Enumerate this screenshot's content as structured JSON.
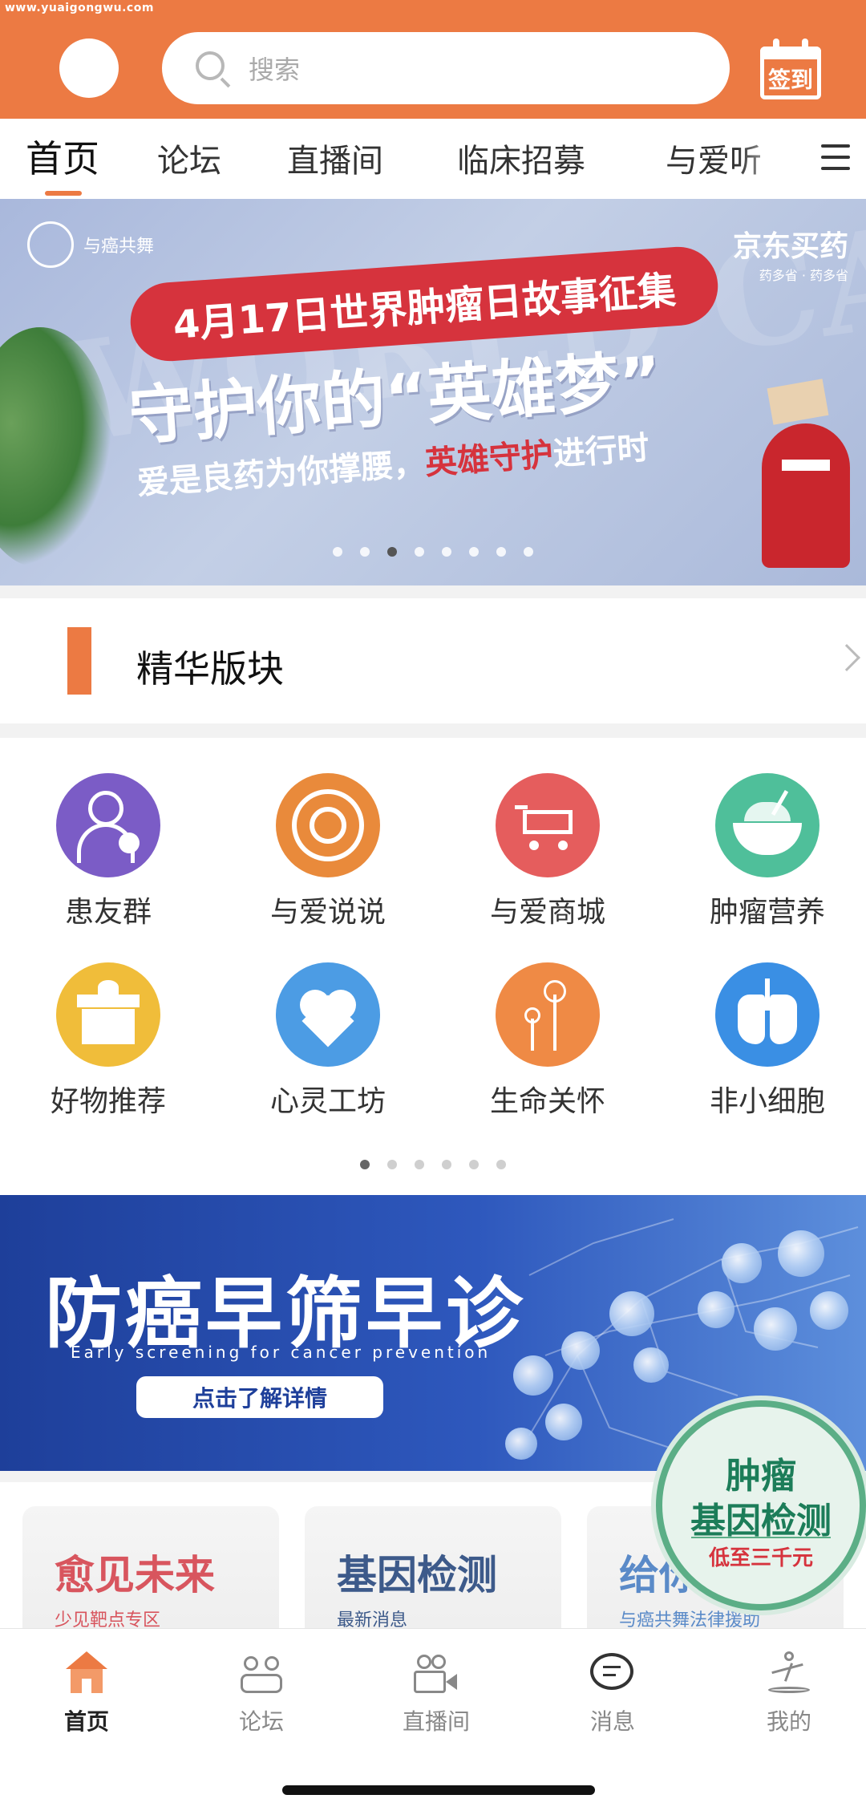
{
  "watermark": "www.yuaigongwu.com",
  "search": {
    "placeholder": "搜索"
  },
  "checkin": {
    "label": "签到"
  },
  "tabs": [
    {
      "label": "首页",
      "active": true
    },
    {
      "label": "论坛"
    },
    {
      "label": "直播间"
    },
    {
      "label": "临床招募"
    },
    {
      "label": "与爱听"
    }
  ],
  "banner": {
    "logo_left": "与癌共舞",
    "logo_right": "京东买药",
    "logo_right_sub": "药多省 · 药多省",
    "pill": "4月17日世界肿瘤日故事征集",
    "slogan": "守护你的“英雄梦”",
    "sub_white": "爱是良药为你撑腰，",
    "sub_red": "英雄守护",
    "sub_tail": "进行时",
    "dots_total": 8,
    "dots_active_index": 2
  },
  "featured": {
    "title": "精华版块"
  },
  "grid": {
    "items": [
      {
        "label": "患友群",
        "icon": "user-plus-icon",
        "color": "#7b5cc6"
      },
      {
        "label": "与爱说说",
        "icon": "camera-lens-icon",
        "color": "#e98a3b"
      },
      {
        "label": "与爱商城",
        "icon": "shopping-cart-icon",
        "color": "#e55d5d"
      },
      {
        "label": "肿瘤营养",
        "icon": "bowl-icon",
        "color": "#4fbf9a"
      },
      {
        "label": "好物推荐",
        "icon": "gift-box-icon",
        "color": "#f0bd3a"
      },
      {
        "label": "心灵工坊",
        "icon": "heart-pulse-icon",
        "color": "#4c9ce4"
      },
      {
        "label": "生命关怀",
        "icon": "dandelion-icon",
        "color": "#ef8a45"
      },
      {
        "label": "非小细胞",
        "icon": "lungs-icon",
        "color": "#3a8fe4"
      }
    ],
    "dots_total": 6,
    "dots_active_index": 0
  },
  "promo": {
    "title": "防癌早筛早诊",
    "subtitle": "Early screening for cancer prevention",
    "button": "点击了解详情"
  },
  "cards": [
    {
      "title": "愈见未来",
      "subtitle": "少见靶点专区",
      "title_color": "#d8555e",
      "sub_color": "#d8555e"
    },
    {
      "title": "基因检测",
      "subtitle": "最新消息",
      "title_color": "#3d5a8a",
      "sub_color": "#3d5a8a"
    },
    {
      "title": "给你",
      "subtitle": "与癌共舞法律援助",
      "title_color": "#5a8ac8",
      "sub_color": "#5a8ac8"
    }
  ],
  "badge": {
    "line1": "肿瘤",
    "line2": "基因检测",
    "line3": "低至三千元"
  },
  "bottom_nav": [
    {
      "label": "首页",
      "icon": "home-icon",
      "active": true
    },
    {
      "label": "论坛",
      "icon": "forum-icon"
    },
    {
      "label": "直播间",
      "icon": "video-camera-icon"
    },
    {
      "label": "消息",
      "icon": "chat-bubble-icon"
    },
    {
      "label": "我的",
      "icon": "profile-dancer-icon"
    }
  ],
  "colors": {
    "brand": "#ec7a43",
    "promo_blue": "#2e58bd",
    "badge_green": "#5bae86"
  }
}
